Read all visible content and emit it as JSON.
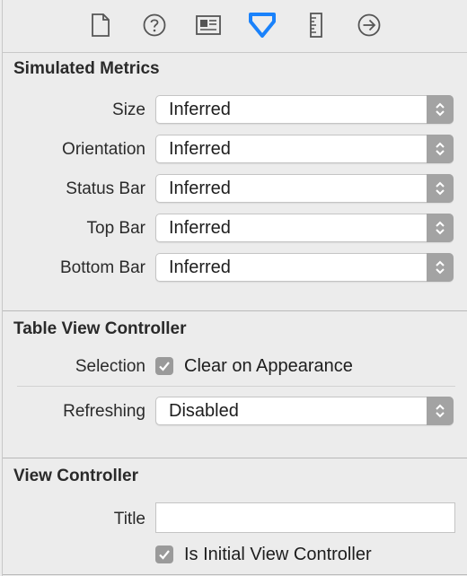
{
  "tabs": [
    {
      "icon": "file-icon",
      "selected": false
    },
    {
      "icon": "help-icon",
      "selected": false
    },
    {
      "icon": "identity-icon",
      "selected": false
    },
    {
      "icon": "attributes-icon",
      "selected": true
    },
    {
      "icon": "ruler-icon",
      "selected": false
    },
    {
      "icon": "connections-icon",
      "selected": false
    }
  ],
  "accent_color": "#1a82fb",
  "simulated_metrics": {
    "title": "Simulated Metrics",
    "rows": [
      {
        "label": "Size",
        "value": "Inferred"
      },
      {
        "label": "Orientation",
        "value": "Inferred"
      },
      {
        "label": "Status Bar",
        "value": "Inferred"
      },
      {
        "label": "Top Bar",
        "value": "Inferred"
      },
      {
        "label": "Bottom Bar",
        "value": "Inferred"
      }
    ]
  },
  "table_view_controller": {
    "title": "Table View Controller",
    "selection_label": "Selection",
    "clear_on_appearance_label": "Clear on Appearance",
    "clear_on_appearance_checked": true,
    "refreshing_label": "Refreshing",
    "refreshing_value": "Disabled"
  },
  "view_controller": {
    "title": "View Controller",
    "title_label": "Title",
    "title_value": "",
    "initial_label": "Is Initial View Controller",
    "initial_checked": true
  }
}
